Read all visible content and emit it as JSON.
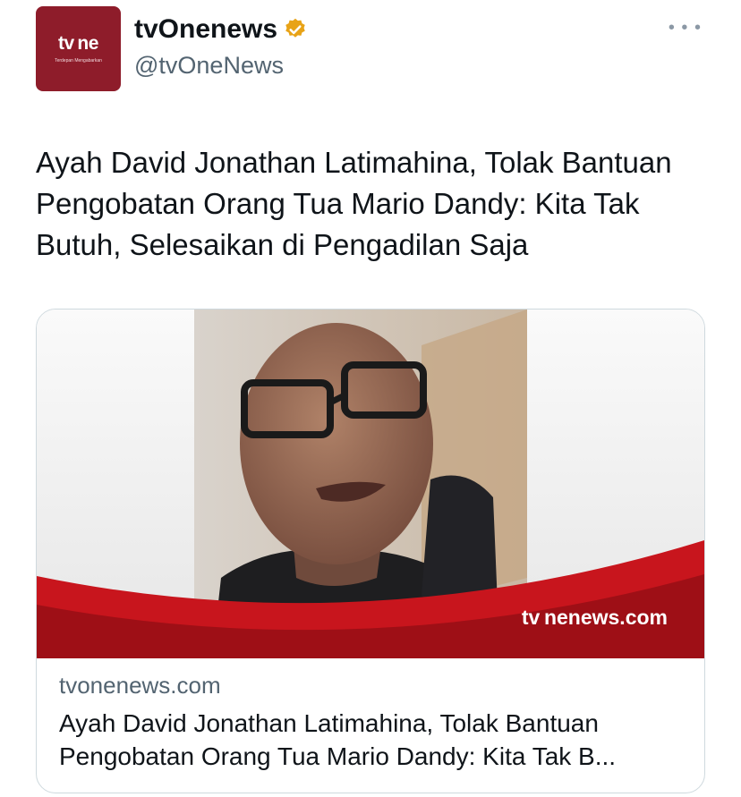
{
  "account": {
    "avatar_logo": "tv ne",
    "avatar_tagline": "Terdepan Mengabarkan",
    "display_name": "tvOnenews",
    "handle": "@tvOneNews",
    "verified_icon": "verified-badge-icon",
    "verified_color": "#e8a317"
  },
  "tweet": {
    "text": "Ayah David Jonathan Latimahina, Tolak Bantuan Pengobatan Orang Tua Mario Dandy: Kita Tak Butuh, Selesaikan di Pengadilan Saja"
  },
  "card": {
    "watermark": "tv nenews.com",
    "domain": "tvonenews.com",
    "title": "Ayah David Jonathan Latimahina, Tolak Bantuan Pengobatan Orang Tua Mario Dandy: Kita Tak B..."
  },
  "colors": {
    "brand_red": "#8e1c2a",
    "accent_red": "#c8151d"
  }
}
